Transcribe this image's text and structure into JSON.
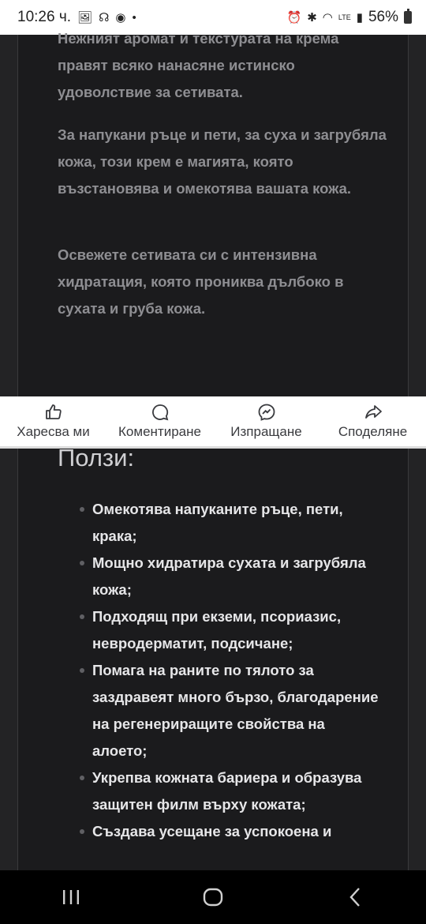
{
  "status_bar": {
    "time": "10:26 ч.",
    "battery": "56%",
    "icons": [
      "gallery-icon",
      "app-icon",
      "messenger-icon",
      "dot-icon",
      "alarm-icon",
      "bluetooth-icon",
      "wifi-icon",
      "volte-icon",
      "signal-icon",
      "battery-icon"
    ]
  },
  "article": {
    "paragraphs": [
      "Нежният аромат и текстурата на крема правят всяко нанасяне истинско удоволствие за сетивата.",
      "За напукани ръце и пети, за суха и загрубяла кожа, този крем е магията, която възстановява и омекотява вашата кожа.",
      "Освежете сетивата си с интензивна хидратация, която прониква дълбоко в сухата и груба кожа."
    ],
    "benefits_heading": "Ползи:",
    "benefits": [
      "Омекотява напуканите ръце, пети, крака;",
      "Мощно хидратира сухата и загрубяла кожа;",
      "Подходящ при екземи, псориазис, невродерматит, подсичане;",
      "Помага на раните по тялото за заздравеят много бързо, благодарение на регенериращите свойства на алоето;",
      "Укрепва кожната бариера и образува защитен филм върху кожата;",
      "Създава усещане за успокоена и"
    ]
  },
  "actions": {
    "like": "Харесва ми",
    "comment": "Коментиране",
    "send": "Изпращане",
    "share": "Споделяне"
  },
  "colors": {
    "page_bg": "#232325",
    "card_bg": "#1b1b1d",
    "paragraph_text": "#8e8e92",
    "list_text": "#e6e6e8"
  }
}
